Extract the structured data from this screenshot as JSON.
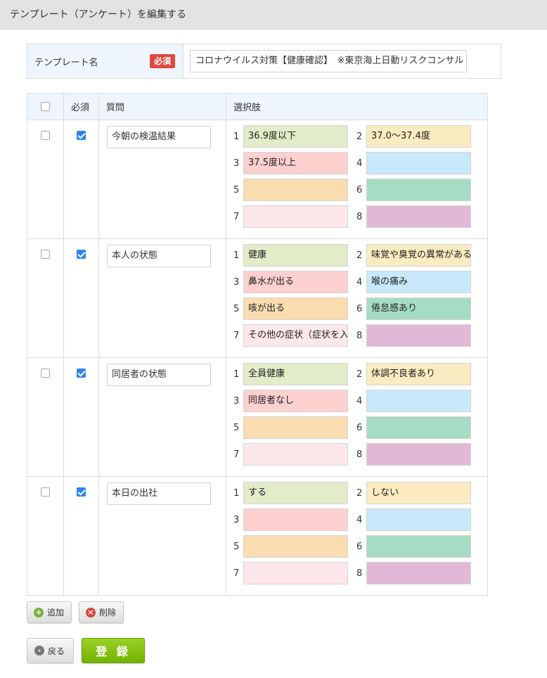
{
  "header": {
    "title": "テンプレート（アンケート）を編集する"
  },
  "template_name": {
    "label": "テンプレート名",
    "required_badge": "必須",
    "value": "コロナウイルス対策【健康確認】　※東京海上日動リスクコンサル"
  },
  "table": {
    "headers": {
      "required": "必須",
      "question": "質問",
      "choices": "選択肢"
    },
    "choice_colors": [
      "#e3ecc9",
      "#faecc0",
      "#fcd0cf",
      "#c8e8fb",
      "#f9dcb0",
      "#a6dcc3",
      "#fde7ea",
      "#e1b8d5"
    ],
    "rows": [
      {
        "question": "今朝の検温結果",
        "selected": false,
        "required": true,
        "choices": [
          {
            "num": "1",
            "text": "36.9度以下"
          },
          {
            "num": "2",
            "text": "37.0〜37.4度"
          },
          {
            "num": "3",
            "text": "37.5度以上"
          },
          {
            "num": "4",
            "text": ""
          },
          {
            "num": "5",
            "text": ""
          },
          {
            "num": "6",
            "text": ""
          },
          {
            "num": "7",
            "text": ""
          },
          {
            "num": "8",
            "text": ""
          }
        ]
      },
      {
        "question": "本人の状態",
        "selected": false,
        "required": true,
        "choices": [
          {
            "num": "1",
            "text": "健康"
          },
          {
            "num": "2",
            "text": "味覚や臭覚の異常がある"
          },
          {
            "num": "3",
            "text": "鼻水が出る"
          },
          {
            "num": "4",
            "text": "喉の痛み"
          },
          {
            "num": "5",
            "text": "咳が出る"
          },
          {
            "num": "6",
            "text": "倦怠感あり"
          },
          {
            "num": "7",
            "text": "その他の症状（症状を入力）"
          },
          {
            "num": "8",
            "text": ""
          }
        ]
      },
      {
        "question": "同居者の状態",
        "selected": false,
        "required": true,
        "choices": [
          {
            "num": "1",
            "text": "全員健康"
          },
          {
            "num": "2",
            "text": "体調不良者あり"
          },
          {
            "num": "3",
            "text": "同居者なし"
          },
          {
            "num": "4",
            "text": ""
          },
          {
            "num": "5",
            "text": ""
          },
          {
            "num": "6",
            "text": ""
          },
          {
            "num": "7",
            "text": ""
          },
          {
            "num": "8",
            "text": ""
          }
        ]
      },
      {
        "question": "本日の出社",
        "selected": false,
        "required": true,
        "choices": [
          {
            "num": "1",
            "text": "する"
          },
          {
            "num": "2",
            "text": "しない"
          },
          {
            "num": "3",
            "text": ""
          },
          {
            "num": "4",
            "text": ""
          },
          {
            "num": "5",
            "text": ""
          },
          {
            "num": "6",
            "text": ""
          },
          {
            "num": "7",
            "text": ""
          },
          {
            "num": "8",
            "text": ""
          }
        ]
      }
    ]
  },
  "actions": {
    "add_label": "追加",
    "delete_label": "削除",
    "back_label": "戻る",
    "submit_label": "登 録"
  }
}
